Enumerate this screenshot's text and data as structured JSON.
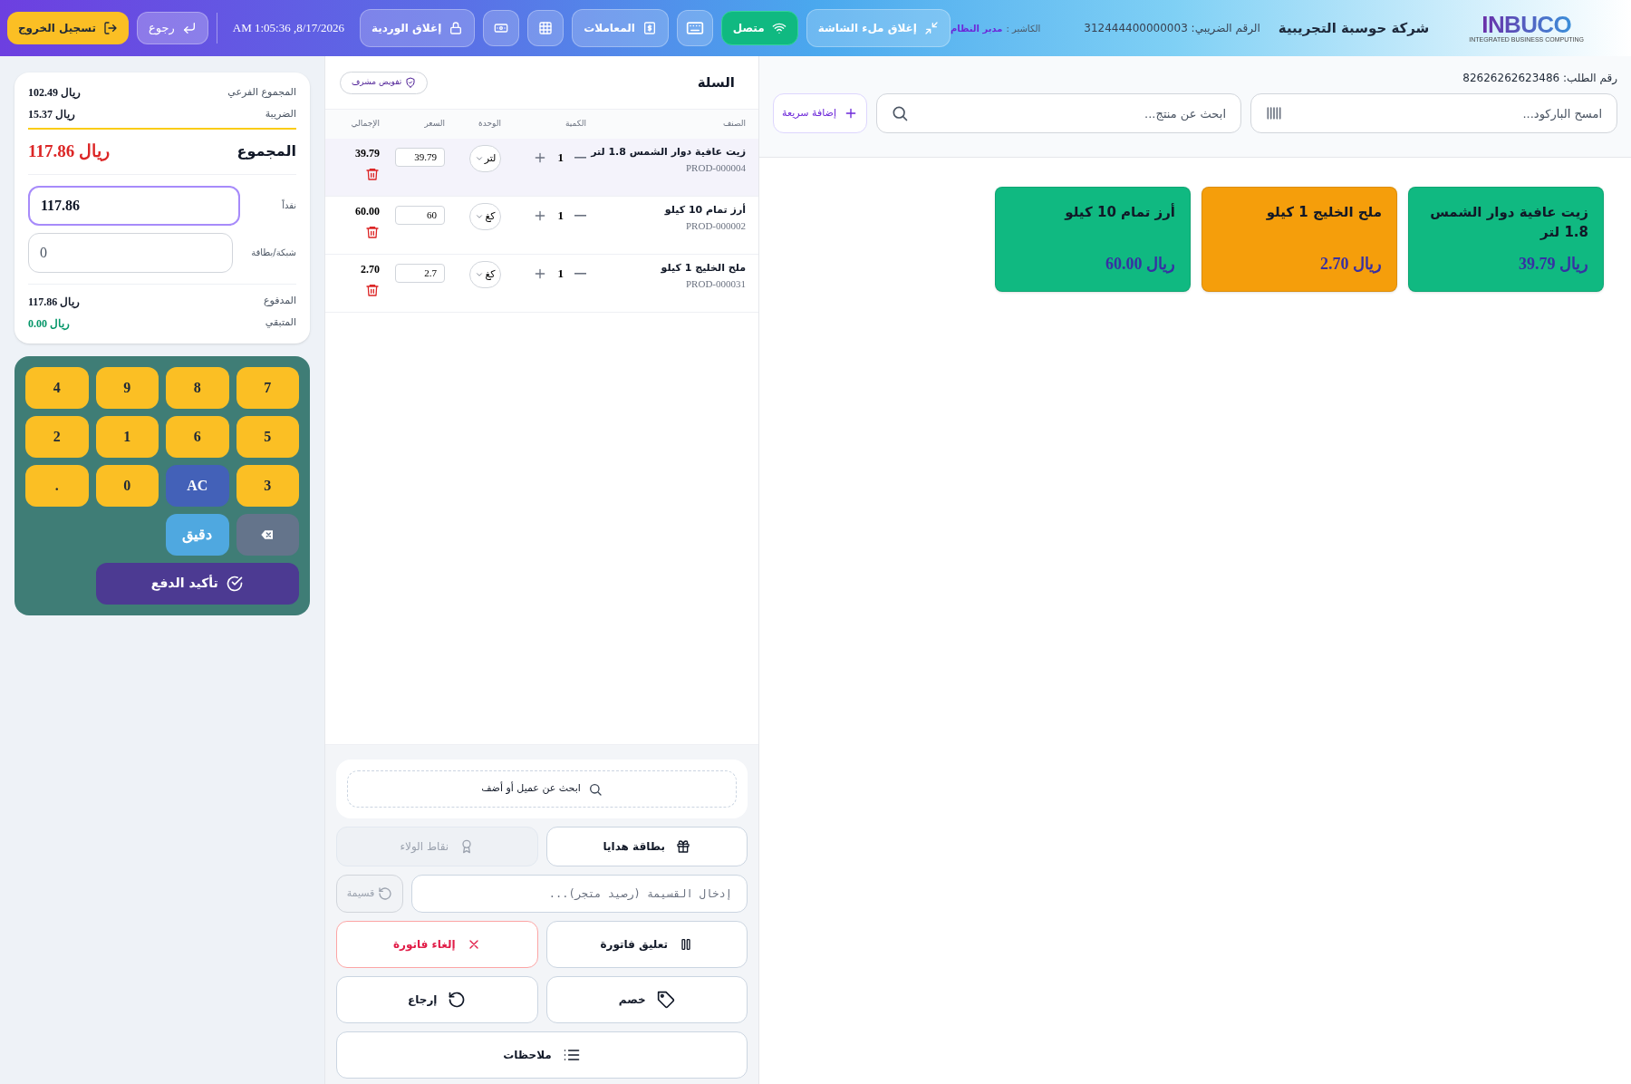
{
  "header": {
    "logo": {
      "name": "INBUCO",
      "tagline": "INTEGRATED BUSINESS COMPUTING"
    },
    "company": "شركة حوسبة التجريبية",
    "tax_number": "الرقم الضريبي: 312444400000003",
    "cashier": {
      "label": "الكاشير :",
      "name": "مدير النظام"
    },
    "fullscreen_button": "إغلاق ملء الشاشة",
    "connection": {
      "label": "متصل",
      "online": true
    },
    "transactions_button": "المعاملات",
    "close_shift_button": "إغلاق الوردية",
    "datetime": "8/17/2026, 1:05:36 AM",
    "back_button": "رجوع",
    "logout_button": "تسجيل الخروج"
  },
  "products": {
    "order_number": "رقم الطلب: 82626262623486",
    "barcode_field": {
      "placeholder": "امسح الباركود..."
    },
    "search_field": {
      "placeholder": "ابحث عن منتج..."
    },
    "quick_add_button": "إضافة سريعة",
    "items": [
      {
        "name": "زيت عافية دوار الشمس 1.8 لتر",
        "price": "39.79 ريال",
        "color": "#10b981"
      },
      {
        "name": "ملح الخليج 1 كيلو",
        "price": "2.70 ريال",
        "color": "#f59e0b"
      },
      {
        "name": "أرز تمام 10 كيلو",
        "price": "60.00 ريال",
        "color": "#10b981"
      }
    ]
  },
  "cart": {
    "title": "السلة",
    "supervisor_button": "تفويض مشرف",
    "columns": [
      "الصنف",
      "الكمية",
      "الوحدة",
      "السعر",
      "الإجمالي"
    ],
    "rows": [
      {
        "name": "زيت عافية دوار الشمس 1.8 لتر",
        "code": "PROD-000004",
        "quantity": "1",
        "unit": "لتر",
        "price": "39.79",
        "total": "39.79",
        "selected": true
      },
      {
        "name": "أرز تمام 10 كيلو",
        "code": "PROD-000002",
        "quantity": "1",
        "unit": "كغ",
        "price": "60",
        "total": "60.00",
        "selected": false
      },
      {
        "name": "ملح الخليج 1 كيلو",
        "code": "PROD-000031",
        "quantity": "1",
        "unit": "كغ",
        "price": "2.7",
        "total": "2.70",
        "selected": false
      }
    ],
    "customer_search": "ابحث عن عميل أو أضف",
    "gift_card_button": "بطاقة هدايا",
    "loyalty_button": {
      "label": "نقاط الولاء",
      "disabled": true
    },
    "voucher": {
      "placeholder": "إدخال القسيمة (رصيد متجر)...",
      "button": "قسيمة",
      "button_disabled": true
    },
    "hold_button": "تعليق فاتورة",
    "cancel_button": "إلغاء فاتورة",
    "discount_button": "خصم",
    "refund_button": "إرجاع",
    "notes_button": "ملاحظات"
  },
  "payment": {
    "subtotal": {
      "label": "المجموع الفرعي",
      "value": "102.49 ريال"
    },
    "tax": {
      "label": "الضريبة",
      "value": "15.37 ريال"
    },
    "total": {
      "label": "المجموع",
      "value": "117.86 ريال"
    },
    "fields": [
      {
        "label": "نقداً",
        "value": "117.86",
        "focused": true
      },
      {
        "label": "شبكة/بطاقة",
        "value": "0",
        "focused": false
      }
    ],
    "paid": {
      "label": "المدفوع",
      "value": "117.86 ريال"
    },
    "remaining": {
      "label": "المتبقي",
      "value": "0.00 ريال"
    },
    "keys": [
      {
        "label": "7",
        "kind": "digit"
      },
      {
        "label": "8",
        "kind": "digit"
      },
      {
        "label": "9",
        "kind": "digit"
      },
      {
        "label": "4",
        "kind": "digit"
      },
      {
        "label": "5",
        "kind": "digit"
      },
      {
        "label": "6",
        "kind": "digit"
      },
      {
        "label": "1",
        "kind": "digit"
      },
      {
        "label": "2",
        "kind": "digit"
      },
      {
        "label": "3",
        "kind": "digit"
      },
      {
        "label": "AC",
        "kind": "clear"
      },
      {
        "label": "0",
        "kind": "digit"
      },
      {
        "label": ".",
        "kind": "digit"
      },
      {
        "kind": "backspace"
      },
      {
        "label": "دقيق",
        "kind": "exact"
      }
    ],
    "confirm_button": "تأكيد الدفع"
  }
}
